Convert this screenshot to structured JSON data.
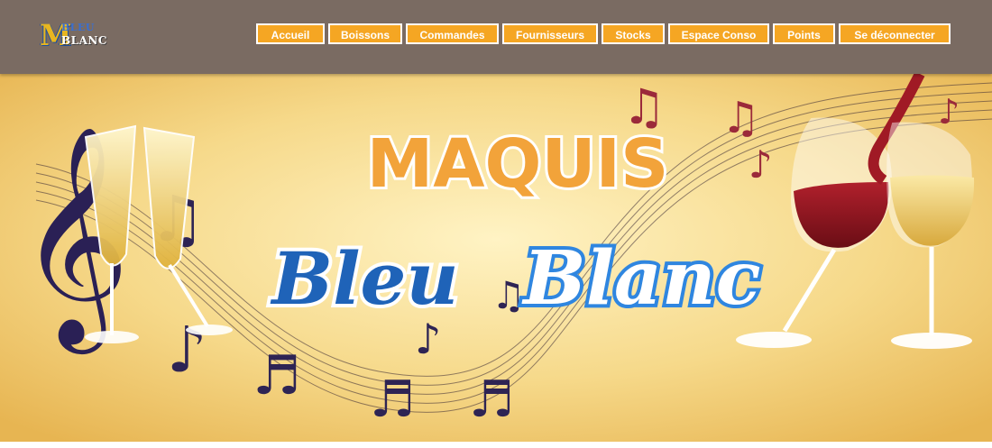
{
  "logo": {
    "letter": "M",
    "top": "BLEU",
    "bottom": "BLANC"
  },
  "nav": {
    "items": [
      {
        "label": "Accueil"
      },
      {
        "label": "Boissons"
      },
      {
        "label": "Commandes"
      },
      {
        "label": "Fournisseurs"
      },
      {
        "label": "Stocks"
      },
      {
        "label": "Espace Conso"
      },
      {
        "label": "Points"
      },
      {
        "label": "Se déconnecter"
      }
    ]
  },
  "banner": {
    "title": "MAQUIS",
    "word1": "Bleu",
    "word2": "Blanc"
  },
  "colors": {
    "header_bg": "#7a6b62",
    "nav_button": "#f5a623",
    "banner_bg": "#f3d27a",
    "title_orange": "#f2a33a",
    "bleu_blue": "#1f63b8",
    "blanc_blue": "#2f86e0"
  }
}
